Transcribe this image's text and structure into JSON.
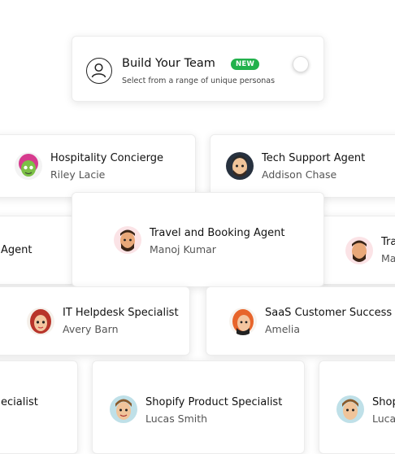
{
  "header": {
    "title": "Build Your Team",
    "badge": "NEW",
    "subtitle": "Select from a range of unique personas"
  },
  "personas": [
    {
      "title": "Hospitality Concierge",
      "name": "Riley Lacie"
    },
    {
      "title": "Tech Support Agent",
      "name": "Addison Chase"
    },
    {
      "title": "Agent",
      "name": ""
    },
    {
      "title": "Travel and Booking Agent",
      "name": "Manoj Kumar"
    },
    {
      "title": "Tra",
      "name": "Ma"
    },
    {
      "title": "IT Helpdesk Specialist",
      "name": "Avery Barn"
    },
    {
      "title": "SaaS Customer Success",
      "name": "Amelia"
    },
    {
      "title": "ecialist",
      "name": ""
    },
    {
      "title": "Shopify Product Specialist",
      "name": "Lucas Smith"
    },
    {
      "title": "Shop",
      "name": "Luca"
    }
  ],
  "colors": {
    "badge": "#22b14c"
  }
}
